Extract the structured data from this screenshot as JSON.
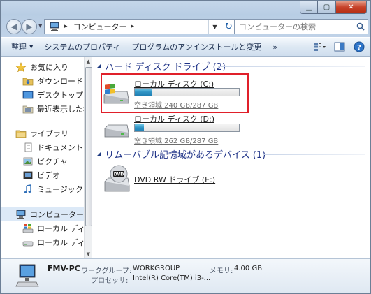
{
  "address": {
    "location": "コンピューター"
  },
  "search": {
    "placeholder": "コンピューターの検索"
  },
  "toolbar": {
    "organize": "整理",
    "system_properties": "システムのプロパティ",
    "uninstall": "プログラムのアンインストールと変更",
    "more": "»"
  },
  "nav": {
    "favorites": "お気に入り",
    "downloads": "ダウンロード",
    "desktop": "デスクトップ",
    "recent": "最近表示した場所",
    "libraries": "ライブラリ",
    "documents": "ドキュメント",
    "pictures": "ピクチャ",
    "videos": "ビデオ",
    "music": "ミュージック",
    "computer": "コンピューター",
    "local_disk_c": "ローカル ディスク",
    "local_disk_d": "ローカル ディスク"
  },
  "groups": {
    "hard_disks": "ハード ディスク ドライブ (2)",
    "removable": "リムーバブル記憶域があるデバイス (1)"
  },
  "drives": [
    {
      "name": "ローカル ディスク (C:)",
      "free": "空き領域 240 GB/287 GB",
      "used_fraction": 0.16
    },
    {
      "name": "ローカル ディスク (D:)",
      "free": "空き領域 262 GB/287 GB",
      "used_fraction": 0.09
    }
  ],
  "dvd": {
    "name": "DVD RW ドライブ (E:)",
    "badge": "DVD"
  },
  "details": {
    "pc_name": "FMV-PC",
    "workgroup_label": "ワークグループ:",
    "workgroup_value": "WORKGROUP",
    "memory_label": "メモリ:",
    "memory_value": "4.00 GB",
    "processor_label": "プロセッサ:",
    "processor_value": "Intel(R) Core(TM) i3-..."
  },
  "colors": {
    "highlight": "#e0202a",
    "group_header": "#1e3287",
    "bar_fill": "#2e93c4"
  }
}
